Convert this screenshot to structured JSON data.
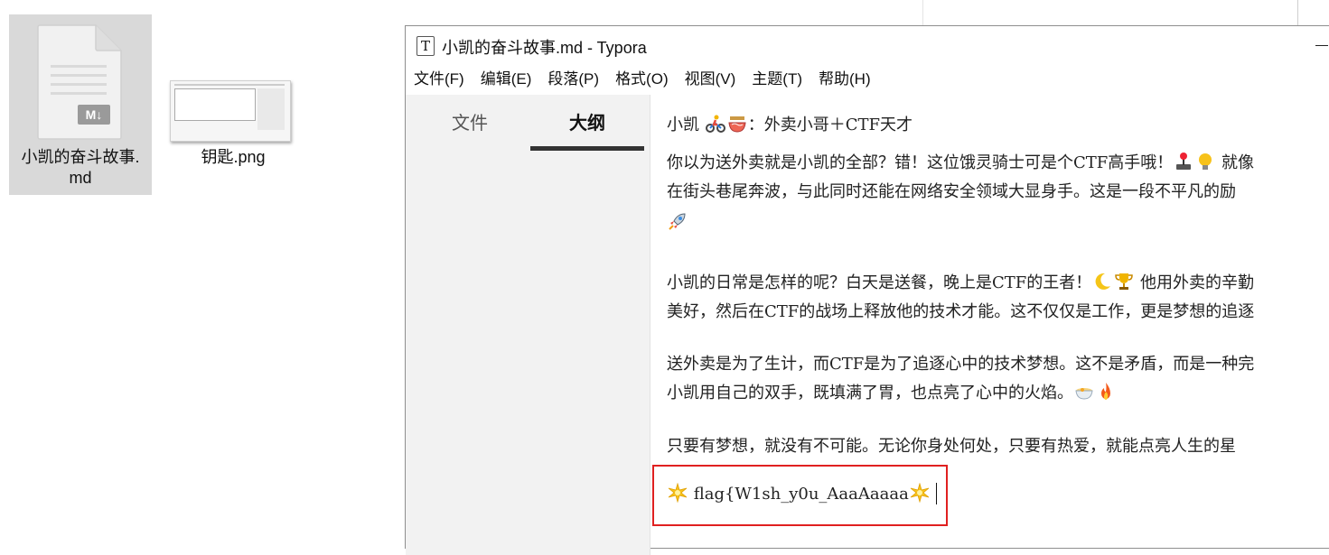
{
  "desktop": {
    "md_file": {
      "label_line1": "小凯的奋斗故事.",
      "label_line2": "md",
      "badge": "M↓"
    },
    "png_file": {
      "label": "钥匙.png"
    }
  },
  "window": {
    "app_icon_letter": "T",
    "title": "小凯的奋斗故事.md - Typora",
    "menu": [
      "文件(F)",
      "编辑(E)",
      "段落(P)",
      "格式(O)",
      "视图(V)",
      "主题(T)",
      "帮助(H)"
    ]
  },
  "sidebar": {
    "tab_files": "文件",
    "tab_outline": "大纲"
  },
  "editor": {
    "p1": {
      "a": "小凯 ",
      "b": "：外卖小哥＋CTF天才"
    },
    "p2_line1": {
      "a": "你以为送外卖就是小凯的全部？错！这位饿灵骑士可是个CTF高手哦！",
      "b": " 就像"
    },
    "p2_line2": "在街头巷尾奔波，与此同时还能在网络安全领域大显身手。这是一段不平凡的励",
    "p3_line1": {
      "a": "小凯的日常是怎样的呢？白天是送餐，晚上是CTF的王者！",
      "b": " 他用外卖的辛勤"
    },
    "p3_line2": "美好，然后在CTF的战场上释放他的技术才能。这不仅仅是工作，更是梦想的追逐",
    "p4_line1": "送外卖是为了生计，而CTF是为了追逐心中的技术梦想。这不是矛盾，而是一种完",
    "p4_line2": "小凯用自己的双手，既填满了胃，也点亮了心中的火焰。",
    "p5": "只要有梦想，就没有不可能。无论你身处何处，只要有热爱，就能点亮人生的星",
    "flag_text": " flag{W1sh_y0u_AaaAaaaa"
  },
  "icons": {
    "cyclist": "cyclist-emoji",
    "noodles": "noodles-emoji",
    "joystick": "joystick-emoji",
    "bulb": "bulb-emoji",
    "rocket": "rocket-emoji",
    "moon": "moon-emoji",
    "trophy": "trophy-emoji",
    "bowl": "bowl-emoji",
    "fire": "fire-emoji",
    "sparkle": "sparkle-emoji"
  },
  "colors": {
    "highlight": "#e02020",
    "sidebar_bg": "#f2f2f2",
    "desktop_selection": "#d9d9d9"
  }
}
